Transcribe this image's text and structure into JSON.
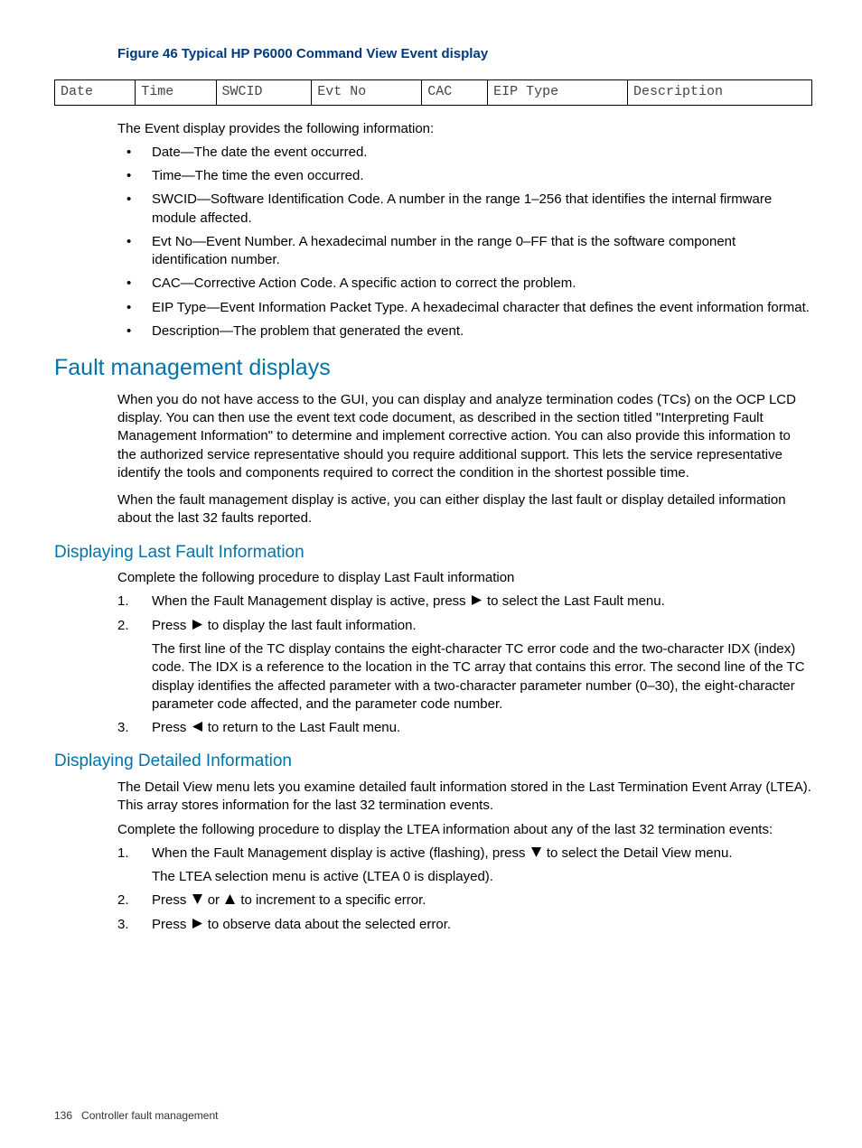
{
  "figure": {
    "label": "Figure 46 Typical HP P6000 Command View Event display"
  },
  "table_headers": [
    "Date",
    "Time",
    "SWCID",
    "Evt No",
    "CAC",
    "EIP Type",
    "Description"
  ],
  "intro_para": "The Event display provides the following information:",
  "bullets": [
    "Date—The date the event occurred.",
    "Time—The time the even occurred.",
    "SWCID—Software Identification Code. A number in the range 1–256 that identifies the internal firmware module affected.",
    "Evt No—Event Number. A hexadecimal number in the range 0–FF that is the software component identification number.",
    "CAC—Corrective Action Code. A specific action to correct the problem.",
    "EIP Type—Event Information Packet Type. A hexadecimal character that defines the event information format.",
    "Description—The problem that generated the event."
  ],
  "sec1": {
    "title": "Fault management displays",
    "p1": "When you do not have access to the GUI, you can display and analyze termination codes (TCs) on the OCP LCD display. You can then use the event text code document, as described in the section titled \"Interpreting Fault Management Information\" to determine and implement corrective action. You can also provide this information to the authorized service representative should you require additional support. This lets the service representative identify the tools and components required to correct the condition in the shortest possible time.",
    "p2": "When the fault management display is active, you can either display the last fault or display detailed information about the last 32 faults reported."
  },
  "sub1": {
    "title": "Displaying Last Fault Information",
    "intro": "Complete the following procedure to display Last Fault information",
    "step1a": "When the Fault Management display is active, press ",
    "step1b": " to select the Last Fault menu.",
    "step2a": "Press ",
    "step2b": " to display the last fault information.",
    "step2sub": "The first line of the TC display contains the eight-character TC error code and the two-character IDX (index) code. The IDX is a reference to the location in the TC array that contains this error. The second line of the TC display identifies the affected parameter with a two-character parameter number (0–30), the eight-character parameter code affected, and the parameter code number.",
    "step3a": "Press ",
    "step3b": " to return to the Last Fault menu."
  },
  "sub2": {
    "title": "Displaying Detailed Information",
    "p1": "The Detail View menu lets you examine detailed fault information stored in the Last Termination Event Array (LTEA). This array stores information for the last 32 termination events.",
    "p2": "Complete the following procedure to display the LTEA information about any of the last 32 termination events:",
    "step1a": "When the Fault Management display is active (flashing), press ",
    "step1b": "to select the Detail View menu.",
    "step1sub": "The LTEA selection menu is active (LTEA 0 is displayed).",
    "step2a": "Press ",
    "step2mid": " or ",
    "step2b": " to increment to a specific error.",
    "step3a": "Press ",
    "step3b": " to observe data about the selected error."
  },
  "footer": {
    "page": "136",
    "section": "Controller fault management"
  }
}
